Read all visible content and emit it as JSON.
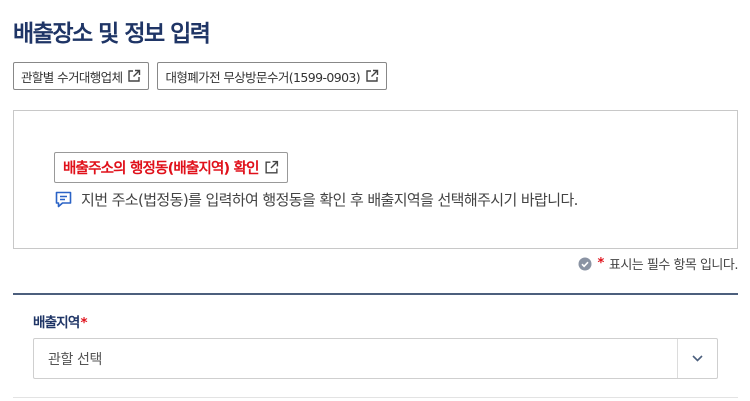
{
  "header": {
    "title": "배출장소 및 정보 입력"
  },
  "links": [
    {
      "label": "관할별 수거대행업체",
      "icon": "external-link-icon"
    },
    {
      "label": "대형폐가전 무상방문수거(1599-0903)",
      "icon": "external-link-icon"
    }
  ],
  "notice": {
    "link_label": "배출주소의 행정동(배출지역) 확인",
    "link_icon": "external-link-icon",
    "help_icon": "comment-icon",
    "help_text": "지번 주소(법정동)를 입력하여 행정동을 확인 후 배출지역을 선택해주시기 바랍니다."
  },
  "required_note": {
    "icon": "check-circle-icon",
    "star": "*",
    "text": "표시는 필수 항목 입니다."
  },
  "form": {
    "region_field": {
      "label": "배출지역",
      "required_mark": "*",
      "selected_value": "관할 선택",
      "arrow_icon": "chevron-down-icon"
    }
  },
  "colors": {
    "title": "#1f3566",
    "accent_red": "#e0101a",
    "divider": "#4c5f7d",
    "check_icon": "#8a93a3"
  }
}
